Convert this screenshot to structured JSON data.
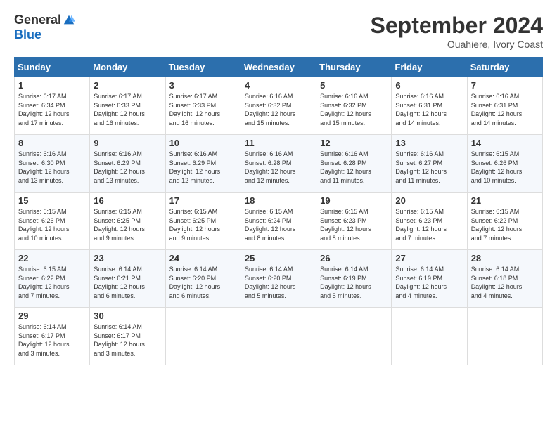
{
  "header": {
    "logo_general": "General",
    "logo_blue": "Blue",
    "month_title": "September 2024",
    "location": "Ouahiere, Ivory Coast"
  },
  "days_of_week": [
    "Sunday",
    "Monday",
    "Tuesday",
    "Wednesday",
    "Thursday",
    "Friday",
    "Saturday"
  ],
  "weeks": [
    [
      {
        "day": "1",
        "sunrise": "6:17 AM",
        "sunset": "6:34 PM",
        "daylight": "12 hours and 17 minutes."
      },
      {
        "day": "2",
        "sunrise": "6:17 AM",
        "sunset": "6:33 PM",
        "daylight": "12 hours and 16 minutes."
      },
      {
        "day": "3",
        "sunrise": "6:17 AM",
        "sunset": "6:33 PM",
        "daylight": "12 hours and 16 minutes."
      },
      {
        "day": "4",
        "sunrise": "6:16 AM",
        "sunset": "6:32 PM",
        "daylight": "12 hours and 15 minutes."
      },
      {
        "day": "5",
        "sunrise": "6:16 AM",
        "sunset": "6:32 PM",
        "daylight": "12 hours and 15 minutes."
      },
      {
        "day": "6",
        "sunrise": "6:16 AM",
        "sunset": "6:31 PM",
        "daylight": "12 hours and 14 minutes."
      },
      {
        "day": "7",
        "sunrise": "6:16 AM",
        "sunset": "6:31 PM",
        "daylight": "12 hours and 14 minutes."
      }
    ],
    [
      {
        "day": "8",
        "sunrise": "6:16 AM",
        "sunset": "6:30 PM",
        "daylight": "12 hours and 13 minutes."
      },
      {
        "day": "9",
        "sunrise": "6:16 AM",
        "sunset": "6:29 PM",
        "daylight": "12 hours and 13 minutes."
      },
      {
        "day": "10",
        "sunrise": "6:16 AM",
        "sunset": "6:29 PM",
        "daylight": "12 hours and 12 minutes."
      },
      {
        "day": "11",
        "sunrise": "6:16 AM",
        "sunset": "6:28 PM",
        "daylight": "12 hours and 12 minutes."
      },
      {
        "day": "12",
        "sunrise": "6:16 AM",
        "sunset": "6:28 PM",
        "daylight": "12 hours and 11 minutes."
      },
      {
        "day": "13",
        "sunrise": "6:16 AM",
        "sunset": "6:27 PM",
        "daylight": "12 hours and 11 minutes."
      },
      {
        "day": "14",
        "sunrise": "6:15 AM",
        "sunset": "6:26 PM",
        "daylight": "12 hours and 10 minutes."
      }
    ],
    [
      {
        "day": "15",
        "sunrise": "6:15 AM",
        "sunset": "6:26 PM",
        "daylight": "12 hours and 10 minutes."
      },
      {
        "day": "16",
        "sunrise": "6:15 AM",
        "sunset": "6:25 PM",
        "daylight": "12 hours and 9 minutes."
      },
      {
        "day": "17",
        "sunrise": "6:15 AM",
        "sunset": "6:25 PM",
        "daylight": "12 hours and 9 minutes."
      },
      {
        "day": "18",
        "sunrise": "6:15 AM",
        "sunset": "6:24 PM",
        "daylight": "12 hours and 8 minutes."
      },
      {
        "day": "19",
        "sunrise": "6:15 AM",
        "sunset": "6:23 PM",
        "daylight": "12 hours and 8 minutes."
      },
      {
        "day": "20",
        "sunrise": "6:15 AM",
        "sunset": "6:23 PM",
        "daylight": "12 hours and 7 minutes."
      },
      {
        "day": "21",
        "sunrise": "6:15 AM",
        "sunset": "6:22 PM",
        "daylight": "12 hours and 7 minutes."
      }
    ],
    [
      {
        "day": "22",
        "sunrise": "6:15 AM",
        "sunset": "6:22 PM",
        "daylight": "12 hours and 7 minutes."
      },
      {
        "day": "23",
        "sunrise": "6:14 AM",
        "sunset": "6:21 PM",
        "daylight": "12 hours and 6 minutes."
      },
      {
        "day": "24",
        "sunrise": "6:14 AM",
        "sunset": "6:20 PM",
        "daylight": "12 hours and 6 minutes."
      },
      {
        "day": "25",
        "sunrise": "6:14 AM",
        "sunset": "6:20 PM",
        "daylight": "12 hours and 5 minutes."
      },
      {
        "day": "26",
        "sunrise": "6:14 AM",
        "sunset": "6:19 PM",
        "daylight": "12 hours and 5 minutes."
      },
      {
        "day": "27",
        "sunrise": "6:14 AM",
        "sunset": "6:19 PM",
        "daylight": "12 hours and 4 minutes."
      },
      {
        "day": "28",
        "sunrise": "6:14 AM",
        "sunset": "6:18 PM",
        "daylight": "12 hours and 4 minutes."
      }
    ],
    [
      {
        "day": "29",
        "sunrise": "6:14 AM",
        "sunset": "6:17 PM",
        "daylight": "12 hours and 3 minutes."
      },
      {
        "day": "30",
        "sunrise": "6:14 AM",
        "sunset": "6:17 PM",
        "daylight": "12 hours and 3 minutes."
      },
      null,
      null,
      null,
      null,
      null
    ]
  ]
}
